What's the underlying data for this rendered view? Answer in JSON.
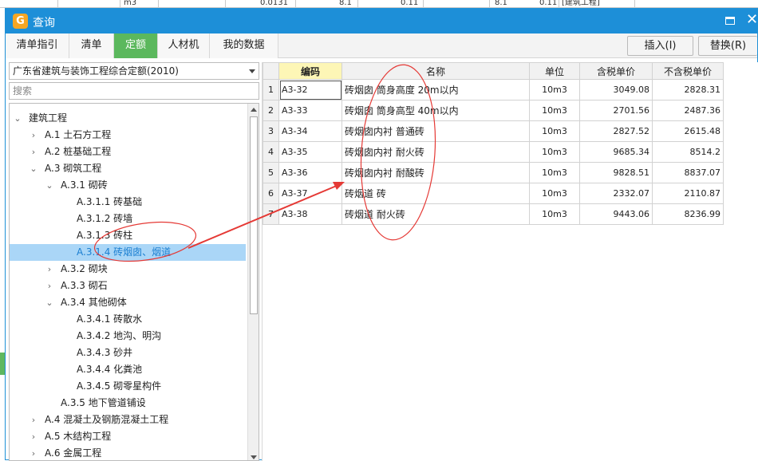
{
  "background": {
    "unit": "m3",
    "qty": "0.0131",
    "v1": "8.1",
    "v2": "0.11",
    "v3": "8.1",
    "v4": "0.11",
    "tag": "[建筑工程]"
  },
  "window": {
    "title": "查询",
    "app_icon": "app-logo-icon"
  },
  "tabs": [
    {
      "label": "清单指引",
      "active": false
    },
    {
      "label": "清单",
      "active": false
    },
    {
      "label": "定额",
      "active": true
    },
    {
      "label": "人材机",
      "active": false
    },
    {
      "label": "我的数据",
      "active": false
    }
  ],
  "actions": {
    "insert": "插入(I)",
    "replace": "替换(R)"
  },
  "library": {
    "selected": "广东省建筑与装饰工程综合定额(2010)"
  },
  "search": {
    "placeholder": "搜索"
  },
  "tree": [
    {
      "level": 0,
      "toggle": "expanded",
      "label": "建筑工程"
    },
    {
      "level": 1,
      "toggle": "collapsed",
      "label": "A.1 土石方工程"
    },
    {
      "level": 1,
      "toggle": "collapsed",
      "label": "A.2 桩基础工程"
    },
    {
      "level": 1,
      "toggle": "expanded",
      "label": "A.3 砌筑工程"
    },
    {
      "level": 2,
      "toggle": "expanded",
      "label": "A.3.1 砌砖"
    },
    {
      "level": 3,
      "toggle": "none",
      "label": "A.3.1.1 砖基础"
    },
    {
      "level": 3,
      "toggle": "none",
      "label": "A.3.1.2 砖墙"
    },
    {
      "level": 3,
      "toggle": "none",
      "label": "A.3.1.3 砖柱"
    },
    {
      "level": 3,
      "toggle": "none",
      "label": "A.3.1.4 砖烟囱、烟道",
      "selected": true
    },
    {
      "level": 2,
      "toggle": "collapsed",
      "label": "A.3.2 砌块"
    },
    {
      "level": 2,
      "toggle": "collapsed",
      "label": "A.3.3 砌石"
    },
    {
      "level": 2,
      "toggle": "expanded",
      "label": "A.3.4 其他砌体"
    },
    {
      "level": 3,
      "toggle": "none",
      "label": "A.3.4.1 砖散水"
    },
    {
      "level": 3,
      "toggle": "none",
      "label": "A.3.4.2 地沟、明沟"
    },
    {
      "level": 3,
      "toggle": "none",
      "label": "A.3.4.3 砂井"
    },
    {
      "level": 3,
      "toggle": "none",
      "label": "A.3.4.4 化粪池"
    },
    {
      "level": 3,
      "toggle": "none",
      "label": "A.3.4.5 砌零星构件"
    },
    {
      "level": 2,
      "toggle": "none",
      "label": "A.3.5 地下管道铺设"
    },
    {
      "level": 1,
      "toggle": "collapsed",
      "label": "A.4 混凝土及钢筋混凝土工程"
    },
    {
      "level": 1,
      "toggle": "collapsed",
      "label": "A.5 木结构工程"
    },
    {
      "level": 1,
      "toggle": "collapsed",
      "label": "A.6 金属工程"
    },
    {
      "level": 1,
      "toggle": "collapsed",
      "label": "A.7 屋面及防水工程"
    }
  ],
  "grid": {
    "columns": [
      "编码",
      "名称",
      "单位",
      "含税单价",
      "不含税单价"
    ],
    "rows": [
      {
        "n": "1",
        "code": "A3-32",
        "name": "砖烟囱 筒身高度 20m以内",
        "unit": "10m3",
        "tax": "3049.08",
        "notax": "2828.31"
      },
      {
        "n": "2",
        "code": "A3-33",
        "name": "砖烟囱 筒身高型 40m以内",
        "unit": "10m3",
        "tax": "2701.56",
        "notax": "2487.36"
      },
      {
        "n": "3",
        "code": "A3-34",
        "name": "砖烟囱内衬 普通砖",
        "unit": "10m3",
        "tax": "2827.52",
        "notax": "2615.48"
      },
      {
        "n": "4",
        "code": "A3-35",
        "name": "砖烟囱内衬 耐火砖",
        "unit": "10m3",
        "tax": "9685.34",
        "notax": "8514.2"
      },
      {
        "n": "5",
        "code": "A3-36",
        "name": "砖烟囱内衬 耐酸砖",
        "unit": "10m3",
        "tax": "9828.51",
        "notax": "8837.07"
      },
      {
        "n": "6",
        "code": "A3-37",
        "name": "砖烟道 砖",
        "unit": "10m3",
        "tax": "2332.07",
        "notax": "2110.87"
      },
      {
        "n": "7",
        "code": "A3-38",
        "name": "砖烟道 耐火砖",
        "unit": "10m3",
        "tax": "9443.06",
        "notax": "8236.99"
      }
    ]
  },
  "colors": {
    "titlebar": "#1d8fd8",
    "active_tab": "#5bb85d",
    "selection": "#aad6f7",
    "annotation": "#e53935"
  }
}
